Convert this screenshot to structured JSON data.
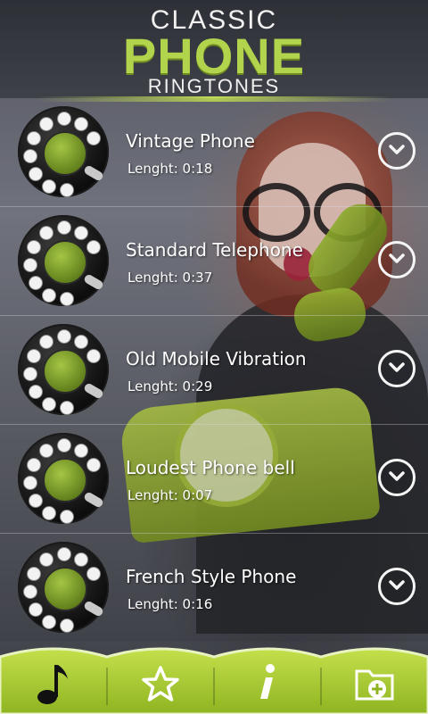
{
  "header": {
    "line1": "CLASSIC",
    "line2": "PHONE",
    "line3": "RINGTONES"
  },
  "ringtones": [
    {
      "name": "Vintage Phone",
      "length": "Lenght: 0:18"
    },
    {
      "name": "Standard Telephone",
      "length": "Lenght: 0:37"
    },
    {
      "name": "Old Mobile Vibration",
      "length": "Lenght: 0:29"
    },
    {
      "name": "Loudest Phone bell",
      "length": "Lenght: 0:07"
    },
    {
      "name": "French Style Phone",
      "length": "Lenght: 0:16"
    }
  ],
  "bottom_nav": [
    {
      "icon": "music-note-icon"
    },
    {
      "icon": "star-icon"
    },
    {
      "icon": "info-icon"
    },
    {
      "icon": "add-folder-icon"
    }
  ],
  "colors": {
    "accent_green": "#b2d34c",
    "bar_green": "#a9cc2f",
    "header_bg": "#2e3037"
  }
}
